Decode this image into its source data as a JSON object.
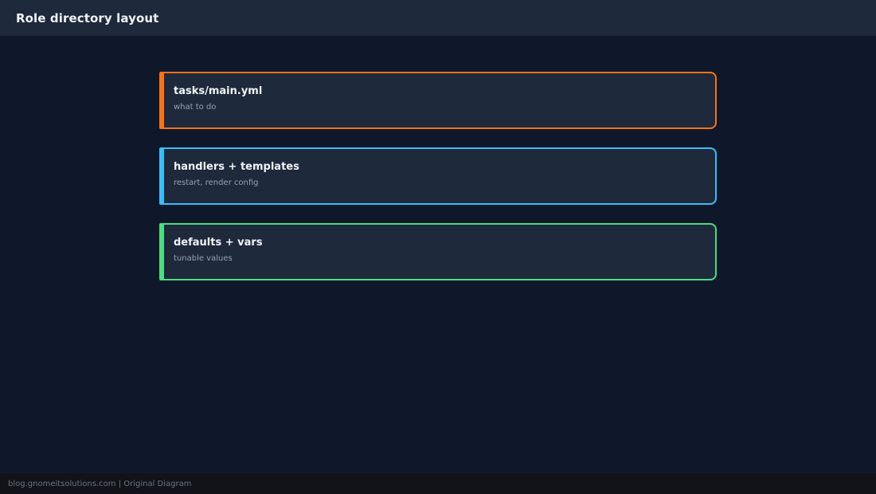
{
  "header": {
    "title": "Role directory layout"
  },
  "cards": [
    {
      "title": "tasks/main.yml",
      "description": "what to do",
      "accent_color": "#f97316"
    },
    {
      "title": "handlers + templates",
      "description": "restart, render config",
      "accent_color": "#38bdf8"
    },
    {
      "title": "defaults + vars",
      "description": "tunable values",
      "accent_color": "#4ade80"
    }
  ],
  "footer": {
    "text": "blog.gnomeitsolutions.com | Original Diagram"
  }
}
